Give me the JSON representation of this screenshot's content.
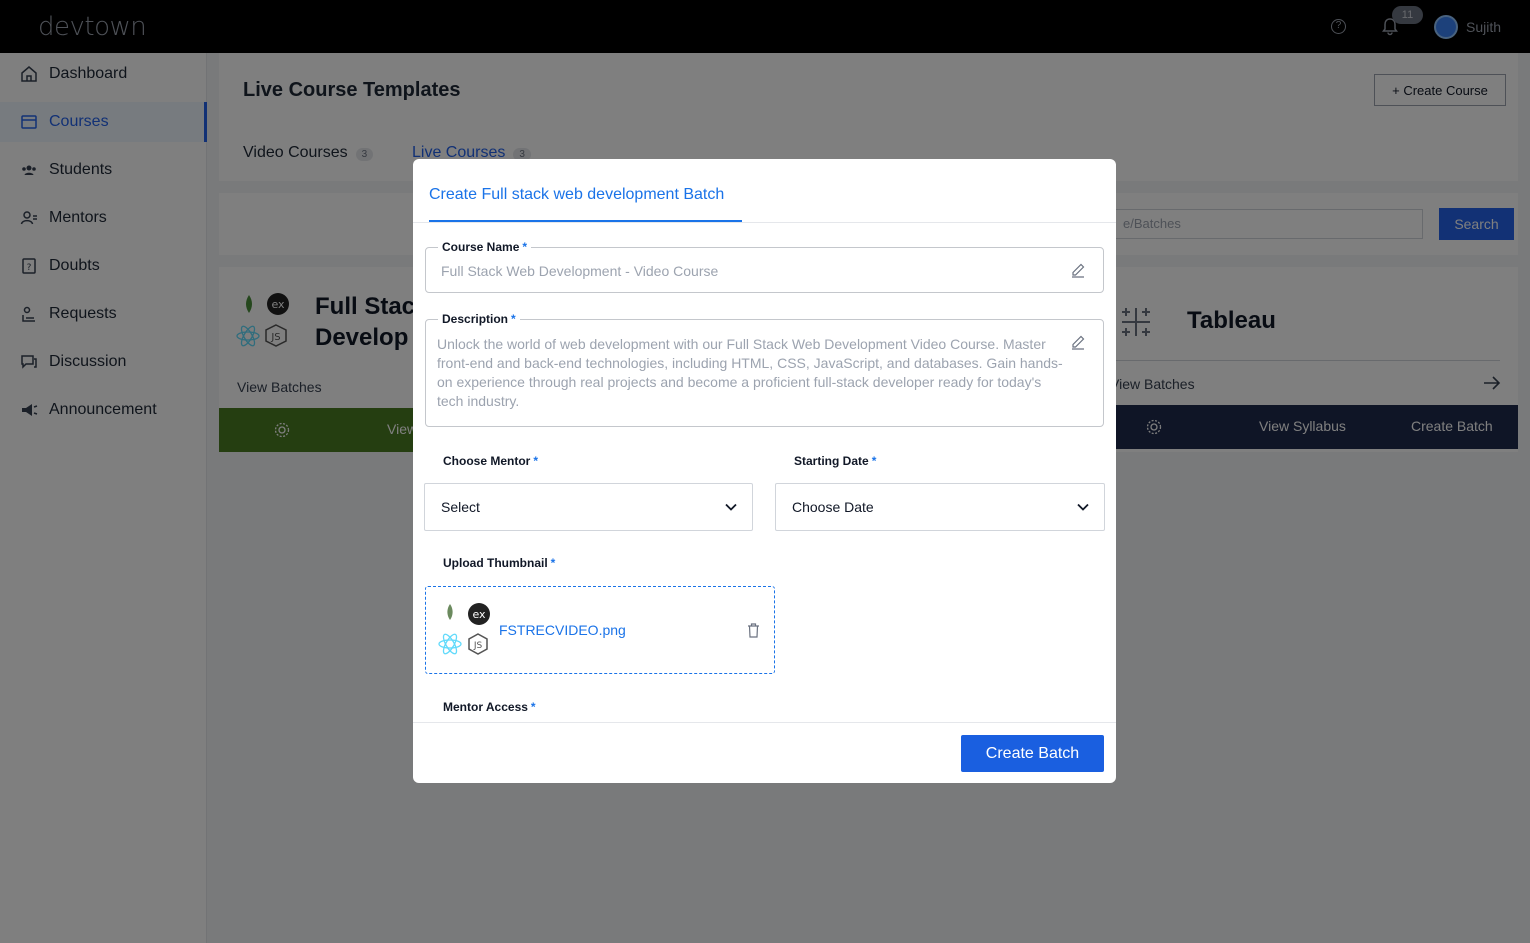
{
  "app": {
    "logo": "devtown"
  },
  "topbar": {
    "notification_count": "11",
    "user_name": "Sujith"
  },
  "sidebar": {
    "items": [
      {
        "label": "Dashboard",
        "icon": "home-icon"
      },
      {
        "label": "Courses",
        "icon": "book-icon",
        "active": true
      },
      {
        "label": "Students",
        "icon": "users-icon"
      },
      {
        "label": "Mentors",
        "icon": "mentor-icon"
      },
      {
        "label": "Doubts",
        "icon": "question-icon"
      },
      {
        "label": "Requests",
        "icon": "request-icon"
      },
      {
        "label": "Discussion",
        "icon": "chat-icon"
      },
      {
        "label": "Announcement",
        "icon": "megaphone-icon"
      }
    ]
  },
  "page": {
    "title": "Live Course Templates",
    "create_course_label": "+ Create Course",
    "tabs": [
      {
        "label": "Video Courses",
        "count": "3"
      },
      {
        "label": "Live Courses",
        "count": "3"
      }
    ],
    "search_placeholder": "e/Batches",
    "search_label": "Search"
  },
  "cards": [
    {
      "title_line1": "Full Stac",
      "title_line2": "Develop",
      "view_batches": "View Batches",
      "footer_middle": "View"
    },
    {
      "title": "Tableau",
      "view_batches": "View Batches",
      "view_syllabus": "View Syllabus",
      "create_batch": "Create Batch"
    }
  ],
  "modal": {
    "title": "Create Full stack web development Batch",
    "course_name_label": "Course Name",
    "course_name_value": "Full Stack Web Development - Video Course",
    "description_label": "Description",
    "description_value": "Unlock the world of web development with our Full Stack Web Development Video Course. Master front-end and back-end technologies, including HTML, CSS, JavaScript, and databases. Gain hands-on experience through real projects and become a proficient full-stack developer ready for today's tech industry.",
    "mentor_label": "Choose Mentor",
    "mentor_value": "Select",
    "date_label": "Starting Date",
    "date_value": "Choose Date",
    "thumbnail_label": "Upload Thumbnail",
    "thumbnail_file": "FSTRECVIDEO.png",
    "mentor_access_label": "Mentor Access",
    "required_mark": "*",
    "create_batch_label": "Create Batch"
  },
  "colors": {
    "accent": "#1a73e8",
    "primary_button": "#1a5fe0",
    "card1_footer": "#4a7c22",
    "card2_footer": "#1f2b4d"
  }
}
